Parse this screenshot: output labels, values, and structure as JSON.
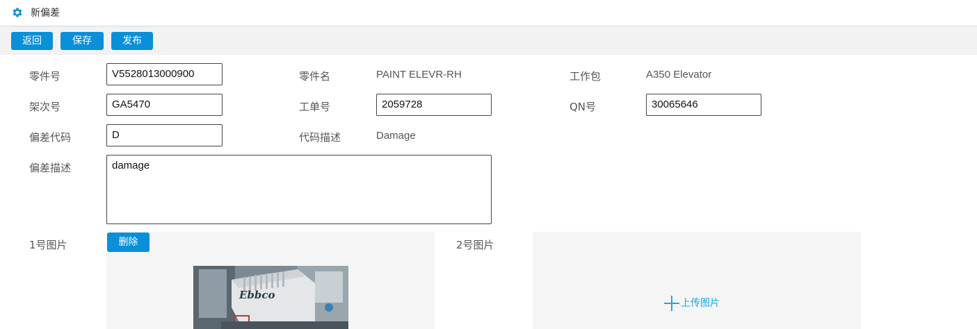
{
  "header": {
    "title": "新偏差",
    "icon": "gear-icon",
    "accent": "#0a8fd9"
  },
  "toolbar": {
    "back_label": "返回",
    "save_label": "保存",
    "publish_label": "发布"
  },
  "form": {
    "part_no_label": "零件号",
    "part_no_value": "V5528013000900",
    "part_name_label": "零件名",
    "part_name_value": "PAINT ELEVR-RH",
    "work_package_label": "工作包",
    "work_package_value": "A350 Elevator",
    "frame_no_label": "架次号",
    "frame_no_value": "GA5470",
    "work_order_label": "工单号",
    "work_order_value": "2059728",
    "qn_label": "QN号",
    "qn_value": "30065646",
    "deviation_code_label": "偏差代码",
    "deviation_code_value": "D",
    "code_desc_label": "代码描述",
    "code_desc_value": "Damage",
    "deviation_desc_label": "偏差描述",
    "deviation_desc_value": "damage"
  },
  "images": {
    "image1_label": "1号图片",
    "delete_label": "删除",
    "photo_brand": "Ebbco",
    "image2_label": "2号图片",
    "upload_label": "上传图片"
  }
}
